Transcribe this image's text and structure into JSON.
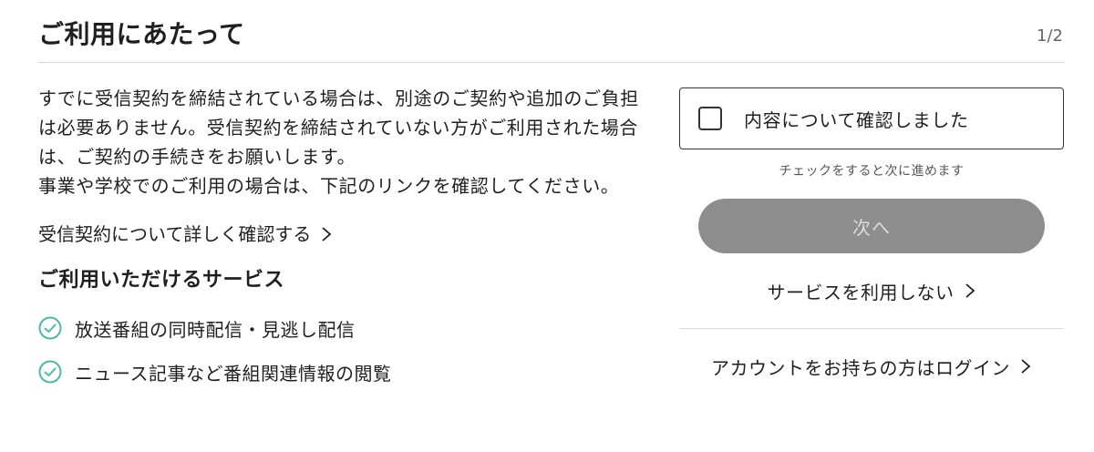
{
  "header": {
    "title": "ご利用にあたって",
    "step": "1/2"
  },
  "main": {
    "description": [
      "すでに受信契約を締結されている場合は、別途のご契約や追加のご負担は必要ありません。受信契約を締結されていない方がご利用された場合は、ご契約の手続きをお願いします。",
      "事業や学校でのご利用の場合は、下記のリンクを確認してください。"
    ],
    "contract_link": "受信契約について詳しく確認する",
    "services_heading": "ご利用いただけるサービス",
    "services": [
      {
        "label": "放送番組の同時配信・見逃し配信",
        "icon": "check-circle-icon"
      },
      {
        "label": "ニュース記事など番組関連情報の閲覧",
        "icon": "check-circle-icon"
      }
    ]
  },
  "side": {
    "confirm_label": "内容について確認しました",
    "confirm_checked": false,
    "hint": "チェックをすると次に進めます",
    "next_button": "次へ",
    "decline_link": "サービスを利用しない",
    "login_link": "アカウントをお持ちの方はログイン"
  },
  "colors": {
    "accent_check": "#4cb8a6",
    "disabled_button_bg": "#8e8e8e",
    "disabled_button_text": "#dcdcdc",
    "divider": "#d9d9d9"
  }
}
